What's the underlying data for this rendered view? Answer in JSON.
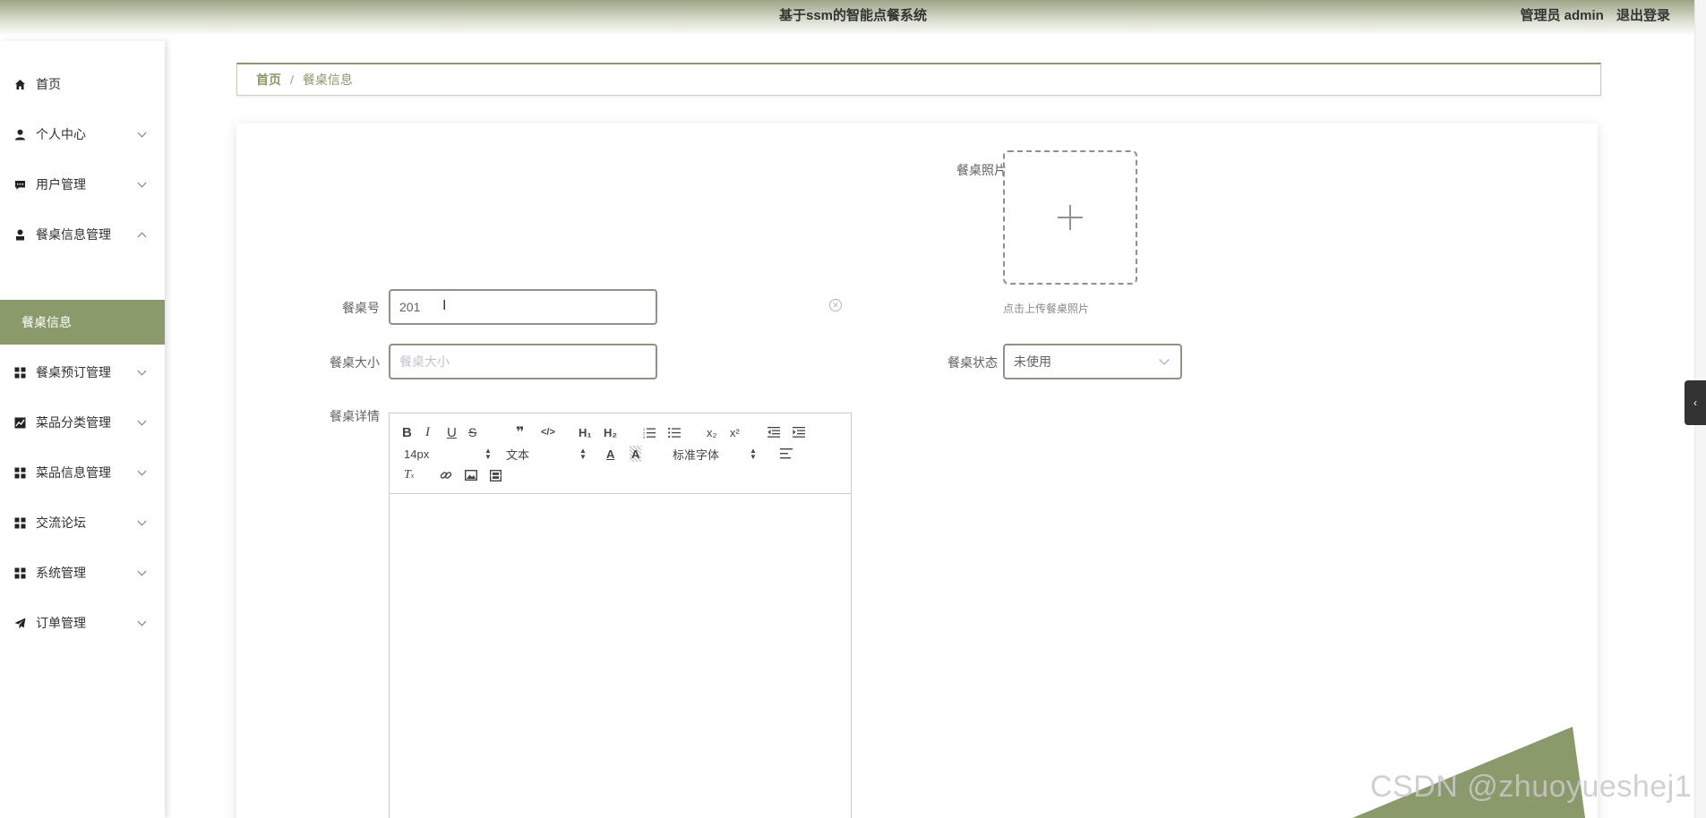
{
  "header": {
    "title": "基于ssm的智能点餐系统",
    "user_role": "管理员 admin",
    "logout_label": "退出登录"
  },
  "sidebar": {
    "items": [
      {
        "label": "首页",
        "icon": "home-icon"
      },
      {
        "label": "个人中心",
        "icon": "user-icon"
      },
      {
        "label": "用户管理",
        "icon": "chat-icon"
      },
      {
        "label": "餐桌信息管理",
        "icon": "person-icon"
      },
      {
        "label": "餐桌预订管理",
        "icon": "grid-icon"
      },
      {
        "label": "菜品分类管理",
        "icon": "chart-icon"
      },
      {
        "label": "菜品信息管理",
        "icon": "grid-icon"
      },
      {
        "label": "交流论坛",
        "icon": "grid-icon"
      },
      {
        "label": "系统管理",
        "icon": "grid-icon"
      },
      {
        "label": "订单管理",
        "icon": "send-icon"
      }
    ],
    "active_submenu": "餐桌信息",
    "accent_color": "#8a9a6b"
  },
  "breadcrumb": {
    "home": "首页",
    "separator": "/",
    "current": "餐桌信息"
  },
  "form": {
    "photo_label": "餐桌照片",
    "upload_tip": "点击上传餐桌照片",
    "table_no_label": "餐桌号",
    "table_no_value": "201",
    "size_label": "餐桌大小",
    "size_placeholder": "餐桌大小",
    "status_label": "餐桌状态",
    "status_value": "未使用",
    "detail_label": "餐桌详情"
  },
  "editor": {
    "font_size": "14px",
    "paragraph": "文本",
    "font_family": "标准字体"
  },
  "watermark": "CSDN @zhuoyueshej1"
}
